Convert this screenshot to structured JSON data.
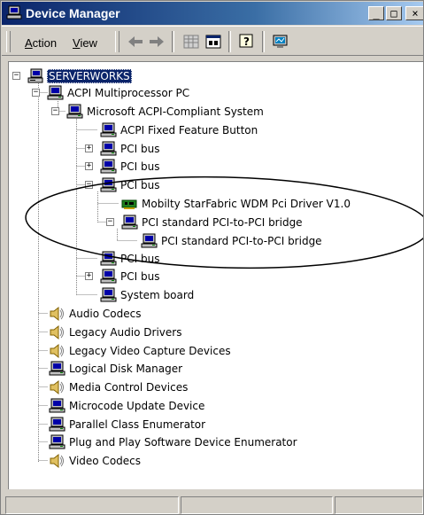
{
  "window": {
    "title": "Device Manager",
    "controls": {
      "minimize": "_",
      "maximize": "□",
      "close": "×"
    }
  },
  "menu": {
    "action": {
      "underline": "A",
      "rest": "ction"
    },
    "view": {
      "underline": "V",
      "rest": "iew"
    }
  },
  "toolbar": {
    "icons": [
      "back-arrow-icon",
      "forward-arrow-icon",
      "grid-view-icon",
      "properties-icon",
      "help-icon",
      "monitor-scan-icon"
    ]
  },
  "tree": {
    "root": "SERVERWORKS",
    "items": [
      {
        "label": "ACPI Multiprocessor PC",
        "icon": "computer-icon"
      },
      {
        "label": "Microsoft ACPI-Compliant System",
        "icon": "computer-icon"
      },
      {
        "label": "ACPI Fixed Feature Button",
        "icon": "computer-icon"
      },
      {
        "label": "PCI bus",
        "icon": "computer-icon"
      },
      {
        "label": "PCI bus",
        "icon": "computer-icon"
      },
      {
        "label": "PCI bus",
        "icon": "computer-icon"
      },
      {
        "label": "Mobilty StarFabric WDM Pci Driver V1.0",
        "icon": "network-card-icon"
      },
      {
        "label": "PCI standard PCI-to-PCI bridge",
        "icon": "computer-icon"
      },
      {
        "label": "PCI standard PCI-to-PCI bridge",
        "icon": "computer-icon"
      },
      {
        "label": "PCI bus",
        "icon": "computer-icon"
      },
      {
        "label": "PCI bus",
        "icon": "computer-icon"
      },
      {
        "label": "System board",
        "icon": "computer-icon"
      },
      {
        "label": "Audio Codecs",
        "icon": "speaker-icon"
      },
      {
        "label": "Legacy Audio Drivers",
        "icon": "speaker-icon"
      },
      {
        "label": "Legacy Video Capture Devices",
        "icon": "speaker-icon"
      },
      {
        "label": "Logical Disk Manager",
        "icon": "computer-icon"
      },
      {
        "label": "Media Control Devices",
        "icon": "speaker-icon"
      },
      {
        "label": "Microcode Update Device",
        "icon": "computer-icon"
      },
      {
        "label": "Parallel Class Enumerator",
        "icon": "computer-icon"
      },
      {
        "label": "Plug and Play Software Device Enumerator",
        "icon": "computer-icon"
      },
      {
        "label": "Video Codecs",
        "icon": "speaker-icon"
      }
    ]
  },
  "colors": {
    "title_gradient_start": "#0a246a",
    "title_gradient_end": "#a6caf0",
    "selection": "#0a246a",
    "chrome": "#d4d0c8"
  }
}
